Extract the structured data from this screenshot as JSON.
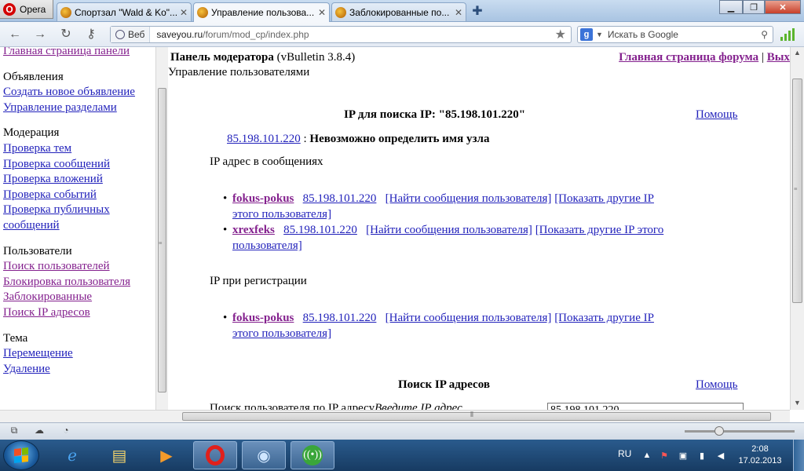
{
  "browser": {
    "menu_label": "Opera",
    "tabs": [
      {
        "label": "Спортзал \"Wald & Ko\"..."
      },
      {
        "label": "Управление пользова..."
      },
      {
        "label": "Заблокированные по..."
      }
    ],
    "address": {
      "scope_label": "Веб",
      "url_host": "saveyou.ru",
      "url_path": "/forum/mod_cp/index.php"
    },
    "search": {
      "engine_letter": "g",
      "placeholder": "Искать в Google"
    }
  },
  "nav": {
    "top_link": "Главная страница панели",
    "groups": [
      {
        "header": "Объявления",
        "items": [
          "Создать новое объявление",
          "Управление разделами"
        ]
      },
      {
        "header": "Модерация",
        "items": [
          "Проверка тем",
          "Проверка сообщений",
          "Проверка вложений",
          "Проверка событий",
          "Проверка публичных сообщений"
        ]
      },
      {
        "header": "Пользователи",
        "items": [
          "Поиск пользователей",
          "Блокировка пользователя",
          "Заблокированные",
          "Поиск IP адресов"
        ]
      },
      {
        "header": "Тема",
        "items": [
          "Перемещение",
          "Удаление"
        ]
      }
    ]
  },
  "header": {
    "panel_title": "Панель модератора",
    "version": "(vBulletin 3.8.4)",
    "subtitle": "Управление пользователями",
    "forum_link": "Главная страница форума",
    "separator": "|",
    "logout_link": "Выход"
  },
  "ip_search": {
    "title": "IP для поиска IP:",
    "ip_quoted": "\"85.198.101.220\"",
    "help_label": "Помощь",
    "host_ip": "85.198.101.220",
    "host_sep": ":",
    "host_result": "Невозможно определить имя узла",
    "posts_section_label": "IP адрес в сообщениях",
    "posts_entries": [
      {
        "user": "fokus-pokus",
        "ip": "85.198.101.220",
        "find_posts": "[Найти сообщения пользователя]",
        "other_ips_1": "[Показать другие IP",
        "other_ips_2": "этого пользователя]"
      },
      {
        "user": "xrexfeks",
        "ip": "85.198.101.220",
        "find_posts": "[Найти сообщения пользователя]",
        "other_ips_1": "[Показать другие IP этого",
        "other_ips_2": "пользователя]"
      }
    ],
    "reg_section_label": "IP при регистрации",
    "reg_entries": [
      {
        "user": "fokus-pokus",
        "ip": "85.198.101.220",
        "find_posts": "[Найти сообщения пользователя]",
        "other_ips_1": "[Показать другие IP",
        "other_ips_2": "этого пользователя]"
      }
    ]
  },
  "ip_form": {
    "title": "Поиск IP адресов",
    "help_label": "Помощь",
    "row_label": "Поиск пользователя по IP адресу",
    "row_hint": "Введите IP адрес",
    "input_value": "85.198.101.220"
  },
  "taskbar": {
    "lang": "RU",
    "time": "2:08",
    "date": "17.02.2013"
  }
}
